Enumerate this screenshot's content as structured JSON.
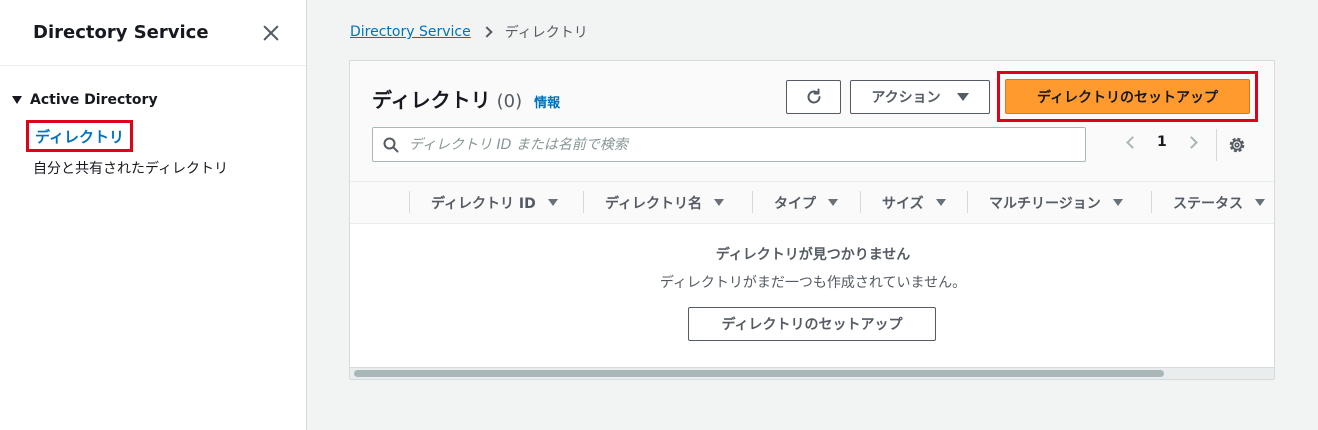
{
  "sidebar": {
    "title": "Directory Service",
    "section": "Active Directory",
    "items": [
      {
        "label": "ディレクトリ",
        "active": true
      },
      {
        "label": "自分と共有されたディレクトリ",
        "active": false
      }
    ]
  },
  "breadcrumb": {
    "root": "Directory Service",
    "current": "ディレクトリ"
  },
  "panel": {
    "title": "ディレクトリ",
    "count": "(0)",
    "info": "情報",
    "actions_label": "アクション",
    "setup_label": "ディレクトリのセットアップ",
    "search_placeholder": "ディレクトリ ID または名前で検索",
    "page": "1"
  },
  "table": {
    "columns": [
      "ディレクトリ ID",
      "ディレクトリ名",
      "タイプ",
      "サイズ",
      "マルチリージョン",
      "ステータス"
    ]
  },
  "empty": {
    "title": "ディレクトリが見つかりません",
    "description": "ディレクトリがまだ一つも作成されていません。",
    "button": "ディレクトリのセットアップ"
  },
  "colors": {
    "primary": "#ff9a2e",
    "link": "#0073bb",
    "highlight": "#e0001b"
  }
}
